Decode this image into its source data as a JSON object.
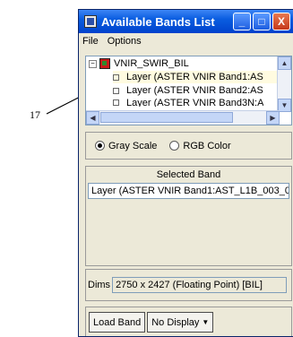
{
  "annotation": {
    "number": "17"
  },
  "window": {
    "title": "Available Bands List",
    "controls": {
      "minimize": "_",
      "maximize": "□",
      "close": "X"
    }
  },
  "menu": {
    "file": "File",
    "options": "Options"
  },
  "tree": {
    "root": "VNIR_SWIR_BIL",
    "expander": "−",
    "items": [
      "Layer (ASTER VNIR Band1:AS",
      "Layer (ASTER VNIR Band2:AS",
      "Layer (ASTER VNIR Band3N:A"
    ],
    "scroll_up": "▲",
    "scroll_down": "▼",
    "scroll_left": "◀",
    "scroll_right": "▶"
  },
  "color_mode": {
    "gray_label": "Gray Scale",
    "rgb_label": "RGB Color",
    "selected": "gray"
  },
  "selected_band": {
    "label": "Selected Band",
    "value": "Layer (ASTER VNIR Band1:AST_L1B_003_0"
  },
  "dims": {
    "label": "Dims",
    "value": "2750 x 2427 (Floating Point) [BIL]"
  },
  "buttons": {
    "load_band": "Load Band",
    "display": "No Display",
    "display_caret": "▼"
  }
}
